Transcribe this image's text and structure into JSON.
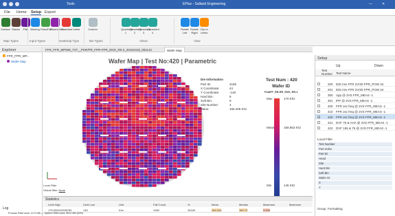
{
  "window": {
    "tools_label": "Tools",
    "title": "EPlus - Salland Engineering"
  },
  "menu": {
    "file": "File",
    "home": "Home",
    "setup": "Setup",
    "export": "Export"
  },
  "ribbon": {
    "buttons": [
      {
        "label": "Surface",
        "color": "#2e7d32"
      },
      {
        "label": "Stacks",
        "color": "#5d4037"
      },
      {
        "label": "Flat",
        "color": "#6a1b9a"
      },
      {
        "label": "Binning",
        "color": "#1e88e5"
      },
      {
        "label": "Pass/Fail",
        "color": "#43a047"
      },
      {
        "label": "Parametric",
        "color": "#8e24aa"
      },
      {
        "label": "Standard",
        "color": "#e53935"
      },
      {
        "label": "Limits",
        "color": "#00897b"
      },
      {
        "label": "Custom",
        "color": "#b0bec5"
      },
      {
        "label": "Quadrant 1",
        "color": "#26a69a"
      },
      {
        "label": "Quadrant 2",
        "color": "#26a69a"
      },
      {
        "label": "Quadrant 3",
        "color": "#26a69a"
      },
      {
        "label": "Quadrant 4",
        "color": "#26a69a"
      },
      {
        "label": "Rotate Left",
        "color": "#1e88e5"
      },
      {
        "label": "Rotate Right",
        "color": "#1e88e5"
      },
      {
        "label": "Clip to Limits",
        "color": "#fb8c00"
      }
    ],
    "groups": {
      "map_types": "Map Types",
      "input_types": "Input Types",
      "heatmap_type": "Heatmap Type",
      "bin_types": "Bin Types",
      "views": "Views",
      "view": "View"
    }
  },
  "explorer": {
    "title": "Explorer",
    "file": "FFR_FPR_MP...",
    "wafer_map": "Wafer Map"
  },
  "tabs": {
    "file": "FFR_FFR_MP608_T37__PHR/FR_FPR-FPR_ENG_R0-2_20161018_091142",
    "wafer": "Wafer Map"
  },
  "wafer": {
    "title": "Wafer Map | Test No:420 | Parametric",
    "die_info_title": "Die Information",
    "die_info": [
      {
        "k": "Part ID:",
        "v": "4185"
      },
      {
        "k": "X Coordinate:",
        "v": "44"
      },
      {
        "k": "Y Coordinate:",
        "v": "-148"
      },
      {
        "k": "Hard Bin:",
        "v": "9"
      },
      {
        "k": "Soft Bin:",
        "v": "9"
      },
      {
        "k": "Site Number:",
        "v": "4"
      },
      {
        "k": "Value:",
        "v": "166.405 Khz"
      }
    ],
    "test_num": "Test Num : 420",
    "wafer_id_label": "Wafer ID",
    "wafer_id": "PoldFF_RR-RR_ENG_RR-2",
    "max_label": "Max",
    "max_value": "170 Khz",
    "mean_label": "Mean",
    "mean_value": "159.853 Khz",
    "min_label": "Min",
    "min_value": "145 Khz",
    "local_filter": "Local Filter",
    "global_filter": "Global filter:",
    "global_value": "None"
  },
  "stats": {
    "title": "Statistics",
    "headers": [
      "Limit High",
      "Limit Low",
      "Unit",
      "Fail Count",
      "%",
      "Mean",
      "Median",
      "Maximum",
      "Maximum"
    ],
    "row": [
      "175.000015258789",
      "145",
      "Khz",
      "1060",
      "34440",
      "154.314",
      "160.73",
      "3.000",
      ""
    ]
  },
  "setup": {
    "title": "Setup",
    "up": "Up",
    "down": "Down",
    "col_num": "Test Number",
    "col_name": "Test Name",
    "tests": [
      {
        "num": "200",
        "name": "IDD rms FFR 2V/25 FPR_POW 34",
        "sel": false
      },
      {
        "num": "201",
        "name": "IDD rms FFR 2V/25 FPR_POW 34",
        "sel": false
      },
      {
        "num": "300",
        "name": "Vpp @ 2VS FFR_MEAS -1",
        "sel": false
      },
      {
        "num": "301",
        "name": "IPP @ 2VS FFR_MEAS -1",
        "sel": false
      },
      {
        "num": "400",
        "name": "FFR osc freq @ 2VS FFR_MEAS -1",
        "sel": false
      },
      {
        "num": "410",
        "name": "FFR osc freq @ 2VS FFR_MEAS -1",
        "sel": false
      },
      {
        "num": "420",
        "name": "FFR osc freq @ 2VS FFR_MEAS -1",
        "sel": true
      },
      {
        "num": "421",
        "name": "DVF 75 & AHA @ 2VS FFR_MEAS -1",
        "sel": false
      },
      {
        "num": "422",
        "name": "DVF 155 & 75 @ 2VS FFR_MEAS -1",
        "sel": false
      }
    ],
    "filter_title": "Local Filter",
    "filters": [
      "Test Number",
      "Part Index",
      "Part ID",
      "Head",
      "Site",
      "Hard Bin",
      "Soft Bin",
      "Wafer ID",
      "X",
      "Y"
    ],
    "group_tab": "Group",
    "format_tab": "Formatting"
  },
  "log": {
    "title": "Log",
    "line": "Process RAM used: 1173 MB — System RAM used: 8512 MB (54%)"
  }
}
